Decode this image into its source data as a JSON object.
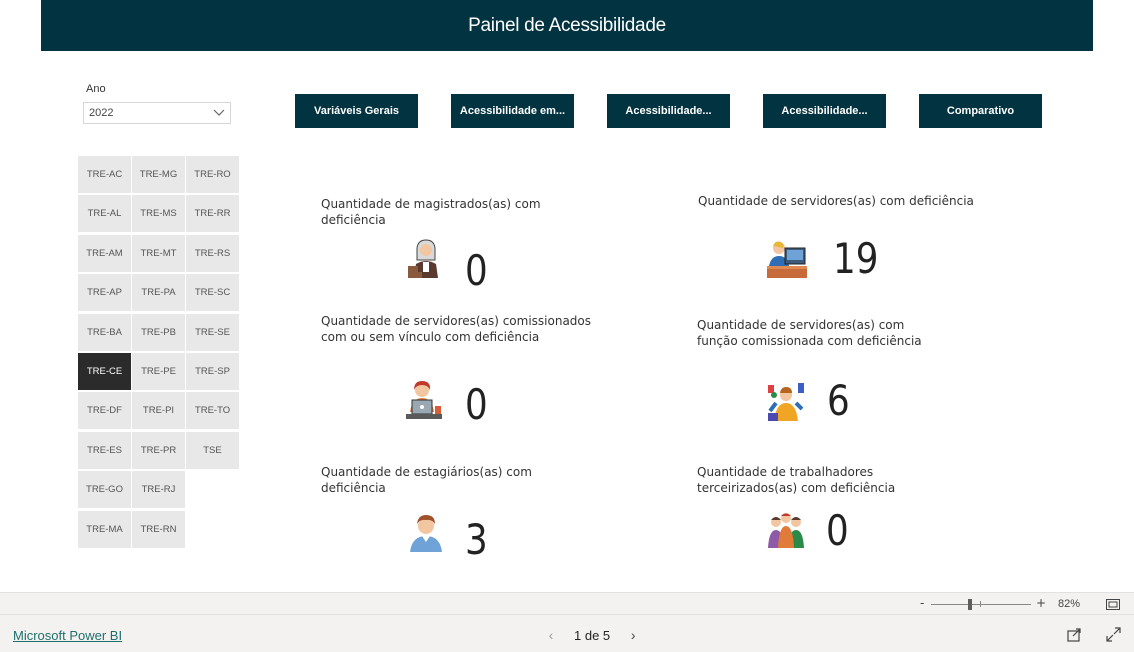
{
  "header": {
    "title": "Painel de Acessibilidade"
  },
  "filters": {
    "ano_label": "Ano",
    "ano_value": "2022"
  },
  "tribunais": [
    "TRE-AC",
    "TRE-MG",
    "TRE-RO",
    "TRE-AL",
    "TRE-MS",
    "TRE-RR",
    "TRE-AM",
    "TRE-MT",
    "TRE-RS",
    "TRE-AP",
    "TRE-PA",
    "TRE-SC",
    "TRE-BA",
    "TRE-PB",
    "TRE-SE",
    "TRE-CE",
    "TRE-PE",
    "TRE-SP",
    "TRE-DF",
    "TRE-PI",
    "TRE-TO",
    "TRE-ES",
    "TRE-PR",
    "TSE",
    "TRE-GO",
    "TRE-RJ",
    "",
    "TRE-MA",
    "TRE-RN",
    ""
  ],
  "selected_tribunal": "TRE-CE",
  "nav": {
    "b1": "Variáveis Gerais",
    "b2": "Acessibilidade em...",
    "b3": "Acessibilidade...",
    "b4": "Acessibilidade...",
    "b5": "Comparativo"
  },
  "cards": {
    "magistrados": {
      "label": "Quantidade de magistrados(as) com deficiência",
      "value": "0",
      "icon": "judge-icon"
    },
    "servidores": {
      "label": "Quantidade de servidores(as) com deficiência",
      "value": "19",
      "icon": "office-worker-icon"
    },
    "comissionados": {
      "label": "Quantidade de servidores(as) comissionados com ou sem vínculo com deficiência",
      "value": "0",
      "icon": "laptop-worker-icon"
    },
    "funcao": {
      "label": "Quantidade de servidores(as) com função comissionada com deficiência",
      "value": "6",
      "icon": "busy-worker-icon"
    },
    "estagiarios": {
      "label": "Quantidade de estagiários(as) com deficiência",
      "value": "3",
      "icon": "young-person-icon"
    },
    "terceirizados": {
      "label": "Quantidade de trabalhadores terceirizados(as) com deficiência",
      "value": "0",
      "icon": "group-people-icon"
    }
  },
  "zoom": {
    "minus": "-",
    "plus": "+",
    "percent": "82%"
  },
  "footer": {
    "brand_link": "Microsoft Power BI",
    "page_indicator": "1 de 5"
  },
  "colors": {
    "header_bg": "#023340",
    "tile_bg": "#e8e8e8",
    "tile_selected": "#2b2b2b"
  }
}
